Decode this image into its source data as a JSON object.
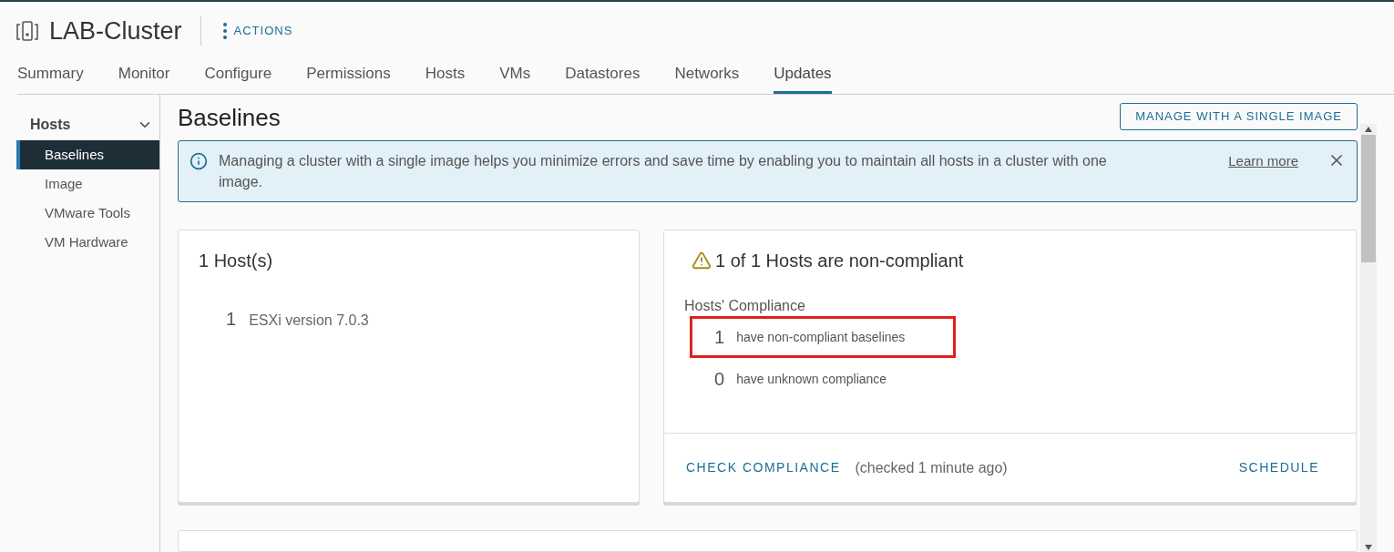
{
  "header": {
    "title": "LAB-Cluster",
    "actions": "ACTIONS"
  },
  "tabs": [
    {
      "label": "Summary",
      "selected": false
    },
    {
      "label": "Monitor",
      "selected": false
    },
    {
      "label": "Configure",
      "selected": false
    },
    {
      "label": "Permissions",
      "selected": false
    },
    {
      "label": "Hosts",
      "selected": false
    },
    {
      "label": "VMs",
      "selected": false
    },
    {
      "label": "Datastores",
      "selected": false
    },
    {
      "label": "Networks",
      "selected": false
    },
    {
      "label": "Updates",
      "selected": true
    }
  ],
  "sidebar": {
    "group": {
      "label": "Hosts",
      "expanded": true
    },
    "items": [
      {
        "label": "Baselines",
        "selected": true
      },
      {
        "label": "Image",
        "selected": false
      },
      {
        "label": "VMware Tools",
        "selected": false
      },
      {
        "label": "VM Hardware",
        "selected": false
      }
    ]
  },
  "page": {
    "title": "Baselines",
    "button": "MANAGE WITH A SINGLE IMAGE"
  },
  "alert": {
    "text": "Managing a cluster with a single image helps you minimize errors and save time by enabling you to maintain all hosts in a cluster with one image.",
    "link": "Learn more"
  },
  "hosts_card": {
    "title": "1 Host(s)",
    "rows": [
      {
        "count": "1",
        "label": "ESXi version 7.0.3"
      }
    ]
  },
  "compliance_card": {
    "title": "1 of 1 Hosts are non-compliant",
    "subtitle": "Hosts' Compliance",
    "rows": [
      {
        "count": "1",
        "label": "have non-compliant baselines",
        "highlighted": true
      },
      {
        "count": "0",
        "label": "have unknown compliance",
        "highlighted": false
      }
    ],
    "check_button": "CHECK COMPLIANCE",
    "checked_note": "(checked 1 minute ago)",
    "schedule_button": "SCHEDULE"
  }
}
